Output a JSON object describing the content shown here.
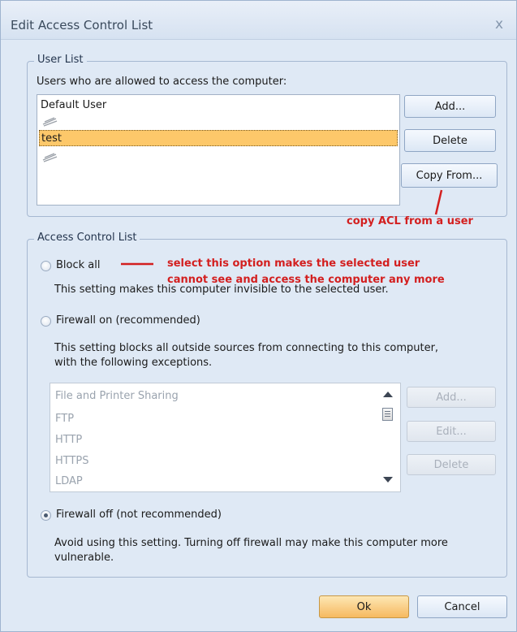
{
  "window": {
    "title": "Edit Access Control List",
    "close_glyph": "x"
  },
  "user_list": {
    "legend": "User List",
    "prompt": "Users who are allowed to access the computer:",
    "users": [
      "Default User",
      "test"
    ],
    "selected_user": "test",
    "buttons": {
      "add": "Add...",
      "delete": "Delete",
      "copy_from": "Copy From..."
    }
  },
  "acl": {
    "legend": "Access Control List",
    "block_all": {
      "label": "Block all",
      "description": "This setting makes this computer invisible to the selected user.",
      "selected": false
    },
    "firewall_on": {
      "label": "Firewall on (recommended)",
      "description_line1": "This setting blocks all outside sources from connecting to this computer,",
      "description_line2": "with the following exceptions.",
      "selected": false
    },
    "exceptions": {
      "items": [
        "File and Printer Sharing",
        "FTP",
        "HTTP",
        "HTTPS",
        "LDAP"
      ],
      "buttons": {
        "add": "Add...",
        "edit": "Edit...",
        "delete": "Delete"
      }
    },
    "firewall_off": {
      "label": "Firewall off (not recommended)",
      "description_line1": "Avoid using this setting. Turning off firewall may make this computer more",
      "description_line2": "vulnerable.",
      "selected": true
    }
  },
  "footer": {
    "ok": "Ok",
    "cancel": "Cancel"
  },
  "annotations": {
    "copy_acl": "copy ACL from a user",
    "block_all_line1": "select this option makes the selected user",
    "block_all_line2": "cannot see and access the computer any more"
  },
  "colors": {
    "window_bg": "#dfe9f5",
    "selection": "#fdc86a",
    "primary_button": "#f6b960",
    "annotation_red": "#d31f1f"
  }
}
